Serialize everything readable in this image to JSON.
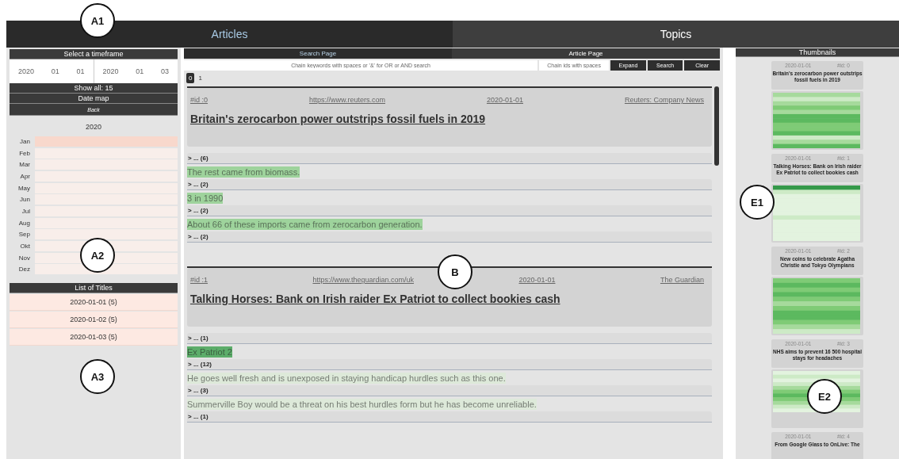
{
  "main_tabs": [
    {
      "label": "Articles",
      "selected": true
    },
    {
      "label": "Topics",
      "selected": false
    }
  ],
  "timeframe": {
    "title": "Select a timeframe",
    "start": [
      "2020",
      "01",
      "01"
    ],
    "end": [
      "2020",
      "01",
      "03"
    ],
    "show_all": "Show all: 15"
  },
  "date_map": {
    "title": "Date map",
    "back": "Back",
    "year": "2020",
    "months": [
      {
        "label": "Jan",
        "color": "#f8d8cc"
      },
      {
        "label": "Feb",
        "color": "#f8eeea"
      },
      {
        "label": "Mar",
        "color": "#f8eeea"
      },
      {
        "label": "Apr",
        "color": "#f8eeea"
      },
      {
        "label": "May",
        "color": "#f8eeea"
      },
      {
        "label": "Jun",
        "color": "#f8eeea"
      },
      {
        "label": "Jul",
        "color": "#f8eeea"
      },
      {
        "label": "Aug",
        "color": "#f8eeea"
      },
      {
        "label": "Sep",
        "color": "#f8eeea"
      },
      {
        "label": "Okt",
        "color": "#f8eeea"
      },
      {
        "label": "Nov",
        "color": "#f8eeea"
      },
      {
        "label": "Dez",
        "color": "#f8eeea"
      }
    ]
  },
  "titles_list": {
    "title": "List of Titles",
    "items": [
      "2020-01-01 (5)",
      "2020-01-02 (5)",
      "2020-01-03 (5)"
    ]
  },
  "page_tabs": [
    {
      "label": "Search Page",
      "selected": true
    },
    {
      "label": "Article Page",
      "selected": false
    }
  ],
  "search": {
    "keywords_placeholder": "Chain keywords with spaces or '&' for OR or AND search",
    "ids_placeholder": "Chain ids with spaces",
    "buttons": [
      "Expand",
      "Search",
      "Clear"
    ]
  },
  "pages": [
    {
      "label": "0",
      "selected": true
    },
    {
      "label": "1",
      "selected": false
    }
  ],
  "articles": [
    {
      "id": "#id :0",
      "url": "https://www.reuters.com",
      "date": "2020-01-01",
      "source": "Reuters: Company News",
      "title": "Britain's zerocarbon power outstrips fossil fuels in 2019",
      "segments": [
        {
          "kind": "collapsed",
          "text": "> ... (6)"
        },
        {
          "kind": "sentence",
          "text": "The rest came from biomass.",
          "color": "#9ed39c"
        },
        {
          "kind": "collapsed",
          "text": "> ... (2)"
        },
        {
          "kind": "sentence",
          "text": "3 in 1990",
          "color": "#9ed39c"
        },
        {
          "kind": "collapsed",
          "text": "> ... (2)"
        },
        {
          "kind": "sentence",
          "text": "About 66 of these imports came from zerocarbon generation.",
          "color": "#9ed39c"
        },
        {
          "kind": "collapsed",
          "text": "> ... (2)"
        }
      ]
    },
    {
      "id": "#id :1",
      "url": "https://www.theguardian.com/uk",
      "date": "2020-01-01",
      "source": "The Guardian",
      "title": "Talking Horses: Bank on Irish raider Ex Patriot to collect bookies cash",
      "segments": [
        {
          "kind": "collapsed",
          "text": "> ... (1)"
        },
        {
          "kind": "sentence",
          "text": "Ex Patriot 2",
          "color": "#5cad6a"
        },
        {
          "kind": "collapsed",
          "text": "> ... (12)"
        },
        {
          "kind": "sentence",
          "text": "He goes well fresh and is unexposed in staying handicap hurdles such as this one.",
          "color": "#dde9d9"
        },
        {
          "kind": "collapsed",
          "text": "> ... (3)"
        },
        {
          "kind": "sentence",
          "text": "Summerville Boy would be a threat on his best hurdles form but he has become unreliable.",
          "color": "#dde9d9"
        },
        {
          "kind": "collapsed",
          "text": "> ... (1)"
        }
      ]
    }
  ],
  "thumbnails": {
    "title": "Thumbnails",
    "items": [
      {
        "date": "2020-01-01",
        "id": "#id: 0",
        "title": "Britain's zerocarbon power outstrips fossil fuels in 2019"
      },
      {
        "date": "2020-01-01",
        "id": "#id: 1",
        "title": "Talking Horses: Bank on Irish raider Ex Patriot to collect bookies cash"
      },
      {
        "date": "2020-01-01",
        "id": "#id: 2",
        "title": "New coins to celebrate Agatha Christie and Tokyo Olympians"
      },
      {
        "date": "2020-01-01",
        "id": "#id: 3",
        "title": "NHS aims to prevent 16 500 hospital stays for headaches"
      },
      {
        "date": "2020-01-01",
        "id": "#id: 4",
        "title": "From Google Glass to OnLive: The"
      }
    ]
  },
  "callouts": [
    "A1",
    "A2",
    "A3",
    "B",
    "E1",
    "E2"
  ]
}
